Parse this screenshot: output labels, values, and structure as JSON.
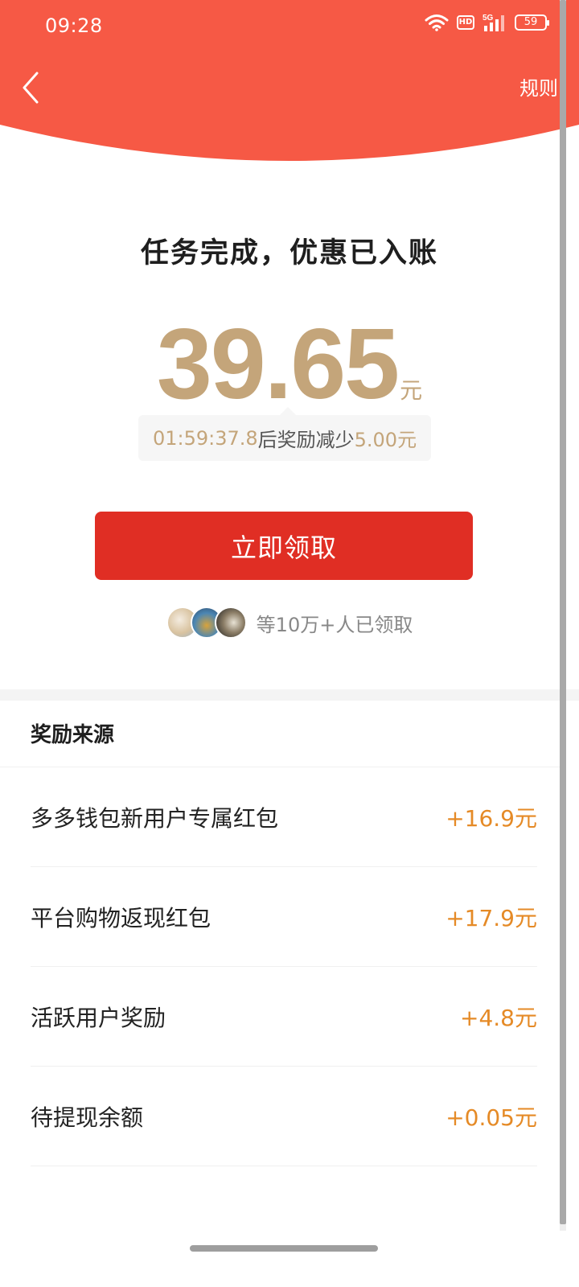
{
  "status_bar": {
    "time": "09:28",
    "hd_label": "HD",
    "network_label": "5G",
    "battery_level": "59"
  },
  "header": {
    "rules_label": "规则",
    "accent_color": "#f65945"
  },
  "main": {
    "headline": "任务完成，优惠已入账",
    "amount": "39.65",
    "amount_unit": "元",
    "amount_color": "#c4a57a",
    "countdown": {
      "time": "01:59:37.8",
      "middle_text": "后奖励减少",
      "reduction": "5.00元"
    },
    "claim_button": "立即领取",
    "claim_button_color": "#e02e24",
    "claimed_text": "等10万+人已领取"
  },
  "rewards": {
    "title": "奖励来源",
    "amount_color": "#e58a26",
    "items": [
      {
        "name": "多多钱包新用户专属红包",
        "amount": "+16.9元"
      },
      {
        "name": "平台购物返现红包",
        "amount": "+17.9元"
      },
      {
        "name": "活跃用户奖励",
        "amount": "+4.8元"
      },
      {
        "name": "待提现余额",
        "amount": "+0.05元"
      }
    ]
  }
}
